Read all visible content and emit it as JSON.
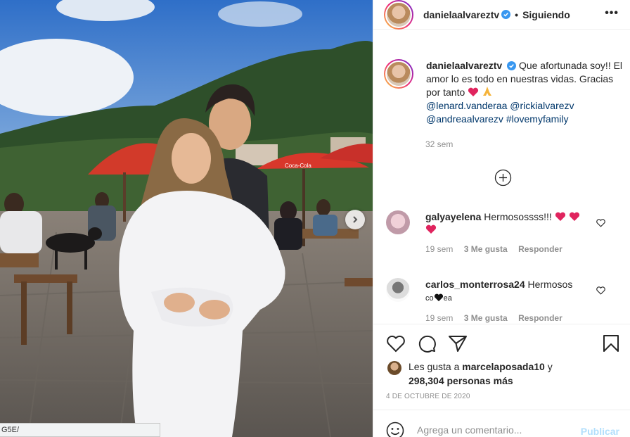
{
  "photo": {
    "url_tooltip": "G5E/",
    "parasol_text": "Coca-Cola"
  },
  "header": {
    "username": "danielaalvareztv",
    "follow_separator": "•",
    "follow_status": "Siguiendo",
    "more_label": "•••",
    "verified_icon": "verified-badge-icon"
  },
  "caption": {
    "username": "danielaalvareztv",
    "text": "Que afortunada soy!! El amor lo es todo en nuestras vidas. Gracias por tanto",
    "mentions": [
      "@lenard.vanderaa",
      "@rickialvarezv",
      "@andreaalvarezv"
    ],
    "hashtag": "#lovemyfamily",
    "time": "32 sem"
  },
  "comments": [
    {
      "username": "galyayelena",
      "text": "Hermosossss!!!",
      "time": "19 sem",
      "likes": "3 Me gusta",
      "reply": "Responder"
    },
    {
      "username": "carlos_monterrosa24",
      "text": "Hermosos",
      "text2_a": "co",
      "text2_b": "ea",
      "time": "19 sem",
      "likes": "3 Me gusta",
      "reply": "Responder"
    }
  ],
  "likes": {
    "prefix": "Les gusta a",
    "user": "marcelaposada10",
    "joiner": "y",
    "count": "298,304 personas más"
  },
  "post_date": "4 DE OCTUBRE DE 2020",
  "comment_box": {
    "placeholder": "Agrega un comentario...",
    "publish_label": "Publicar"
  },
  "colors": {
    "accent_blue": "#0095f6",
    "publish_disabled": "#b2dffc",
    "heart_red": "#ed4956",
    "verified_blue": "#3897f0"
  }
}
